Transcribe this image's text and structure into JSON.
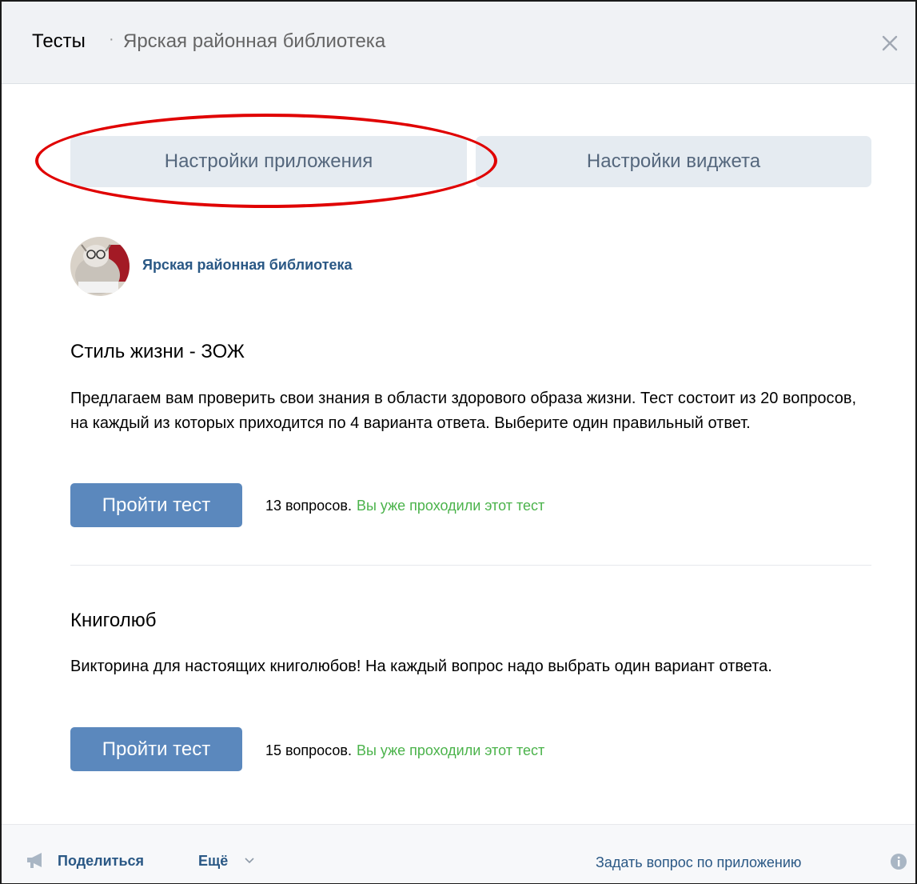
{
  "window": {
    "title": "Тесты",
    "separator": "·",
    "subtitle": "Ярская районная библиотека"
  },
  "tabs": [
    {
      "label": "Настройки приложения"
    },
    {
      "label": "Настройки виджета"
    }
  ],
  "group": {
    "name": "Ярская районная библиотека"
  },
  "tests": [
    {
      "title": "Стиль жизни - ЗОЖ",
      "description": "Предлагаем вам проверить свои знания в области здорового образа жизни. Тест состоит из 20 вопросов, на каждый из которых приходится по 4 варианта ответа. Выберите один правильный ответ.",
      "button_label": "Пройти тест",
      "questions": "13 вопросов.",
      "status": "Вы уже проходили этот тест"
    },
    {
      "title": "Книголюб",
      "description": "Викторина для настоящих книголюбов! На каждый вопрос надо выбрать один вариант ответа.",
      "button_label": "Пройти тест",
      "questions": "15 вопросов.",
      "status": "Вы уже проходили этот тест"
    }
  ],
  "footer": {
    "share_label": "Поделиться",
    "more_label": "Ещё",
    "ask_label": "Задать вопрос по приложению"
  },
  "colors": {
    "accent": "#5b88bd",
    "link": "#2a5885",
    "status_green": "#4bb34b",
    "highlight": "#e00000"
  },
  "icons": [
    "close-icon",
    "megaphone-icon",
    "chevron-down-icon",
    "info-icon"
  ]
}
